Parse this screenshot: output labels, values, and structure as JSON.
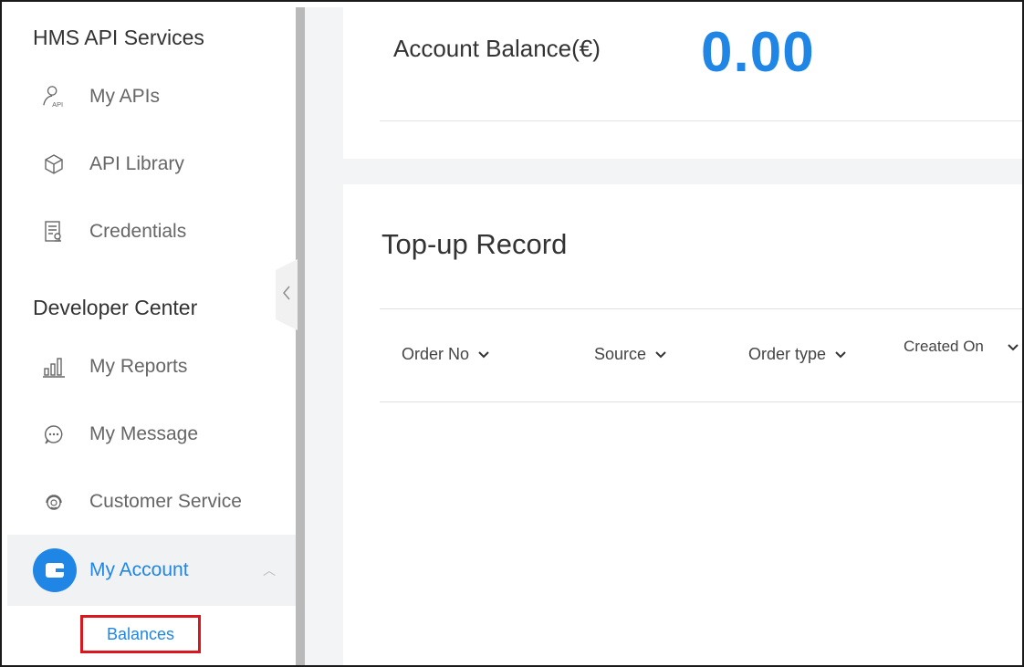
{
  "sidebar": {
    "section_api": "HMS API Services",
    "section_dev": "Developer Center",
    "items": [
      {
        "label": "My APIs",
        "icon": "api-user-icon"
      },
      {
        "label": "API Library",
        "icon": "cube-icon"
      },
      {
        "label": "Credentials",
        "icon": "credentials-icon"
      },
      {
        "label": "My Reports",
        "icon": "bar-chart-icon"
      },
      {
        "label": "My Message",
        "icon": "chat-bubble-icon"
      },
      {
        "label": "Customer Service",
        "icon": "headset-icon"
      },
      {
        "label": "My Account",
        "icon": "wallet-icon",
        "active": true
      }
    ],
    "sub_item": "Balances",
    "api_badge": "API"
  },
  "balance": {
    "label": "Account Balance(€)",
    "value": "0.00"
  },
  "records": {
    "title": "Top-up Record",
    "columns": [
      "Order No",
      "Source",
      "Order type",
      "Created On"
    ]
  },
  "colors": {
    "accent": "#1f86e6",
    "highlight_border": "#d7181e"
  }
}
